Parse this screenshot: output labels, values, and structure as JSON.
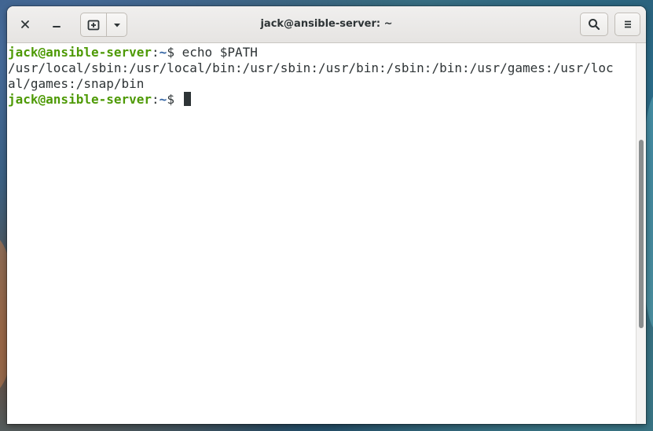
{
  "window": {
    "title": "jack@ansible-server: ~"
  },
  "headerbar": {
    "close_icon": "close-icon",
    "minimize_icon": "minimize-icon",
    "new_tab_icon": "new-tab-icon",
    "dropdown_icon": "chevron-down-icon",
    "search_icon": "search-icon",
    "menu_icon": "hamburger-menu-icon"
  },
  "terminal": {
    "prompt_user_host": "jack@ansible-server",
    "prompt_separator": ":",
    "prompt_cwd": "~",
    "prompt_symbol": "$ ",
    "command": "echo $PATH",
    "output_lines": [
      "/usr/local/sbin:/usr/local/bin:/usr/sbin:/usr/bin:/sbin:/bin:/usr/games:/usr/loc",
      "al/games:/snap/bin"
    ]
  },
  "scrollbar": {
    "position_fraction": 0.5
  },
  "colors": {
    "prompt_user_host": "#4e9a06",
    "prompt_cwd": "#3465a4",
    "text": "#2e3436",
    "headerbar": "#e8e6e4"
  }
}
